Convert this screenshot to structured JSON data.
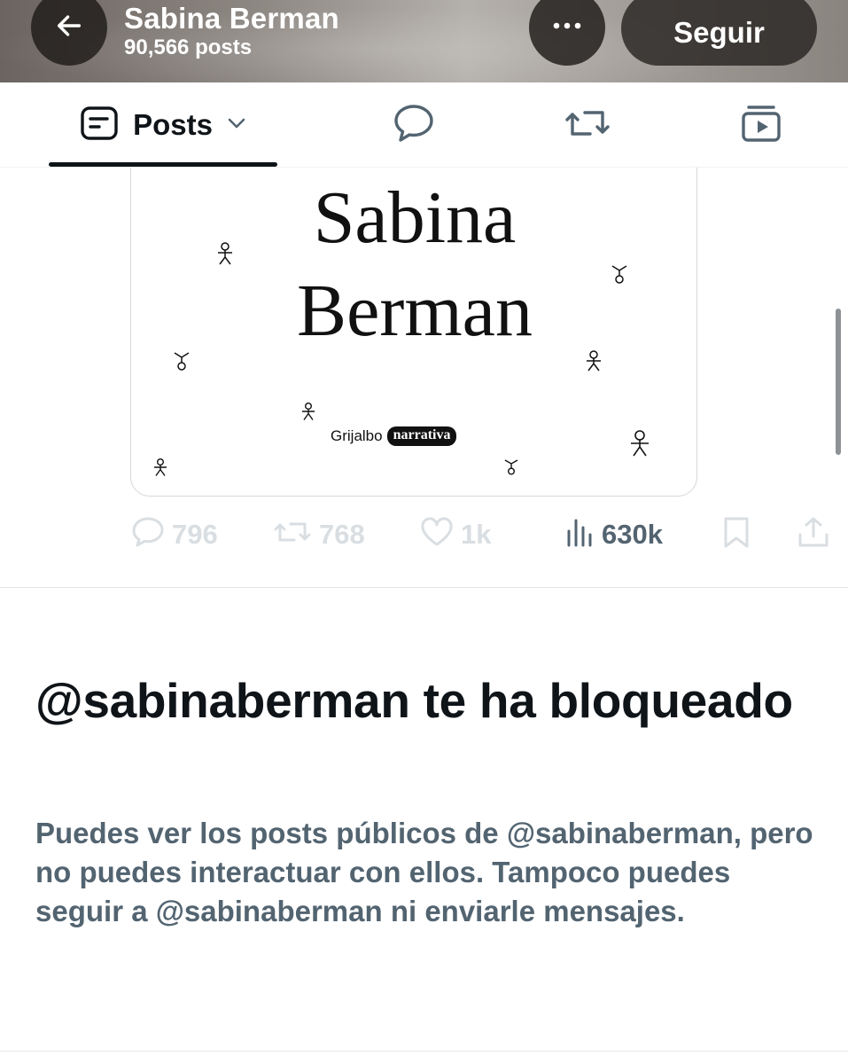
{
  "header": {
    "name": "Sabina Berman",
    "post_count": "90,566 posts",
    "follow_label": "Seguir",
    "back_icon": "arrow-left-icon",
    "more_icon": "more-horizontal-icon"
  },
  "tabs": {
    "posts_label": "Posts",
    "posts_icon": "posts-list-icon",
    "dropdown_icon": "chevron-down-icon",
    "replies_icon": "speech-bubble-icon",
    "reposts_icon": "repost-icon",
    "media_icon": "video-media-icon"
  },
  "post": {
    "image": {
      "title_line1": "Sabina",
      "title_line2": "Berman",
      "publisher": "Grijalbo",
      "publisher_badge": "narrativa"
    },
    "actions": {
      "replies": "796",
      "reposts": "768",
      "likes": "1k",
      "views": "630k"
    }
  },
  "blocked": {
    "title": "@sabinaberman te ha bloqueado",
    "body": "Puedes ver los posts públicos de @sabinaberman, pero no puedes interactuar con ellos. Tampoco puedes seguir a @sabinaberman ni enviarle mensajes."
  },
  "colors": {
    "text_primary": "#0f1419",
    "text_secondary": "#536471",
    "disabled_icon": "#d9dee2"
  }
}
